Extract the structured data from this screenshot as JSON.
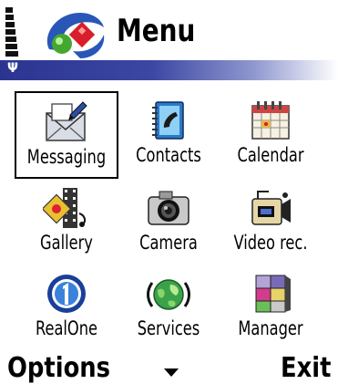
{
  "title_bar": {
    "title": "Menu",
    "signal_icon": "signal-strength-icon",
    "antenna_icon": "antenna-icon"
  },
  "menu": {
    "selected_index": 0,
    "items": [
      {
        "label": "Messaging",
        "icon": "messaging-icon"
      },
      {
        "label": "Contacts",
        "icon": "contacts-icon"
      },
      {
        "label": "Calendar",
        "icon": "calendar-icon"
      },
      {
        "label": "Gallery",
        "icon": "gallery-icon"
      },
      {
        "label": "Camera",
        "icon": "camera-icon"
      },
      {
        "label": "Video rec.",
        "icon": "video-recorder-icon"
      },
      {
        "label": "RealOne",
        "icon": "realone-icon"
      },
      {
        "label": "Services",
        "icon": "services-globe-icon"
      },
      {
        "label": "Manager",
        "icon": "manager-cubes-icon"
      }
    ]
  },
  "softkeys": {
    "left": "Options",
    "right": "Exit"
  },
  "colors": {
    "title_gradient_start": "#2b3591",
    "title_gradient_end": "#ffffff",
    "selection_border": "#000000"
  }
}
